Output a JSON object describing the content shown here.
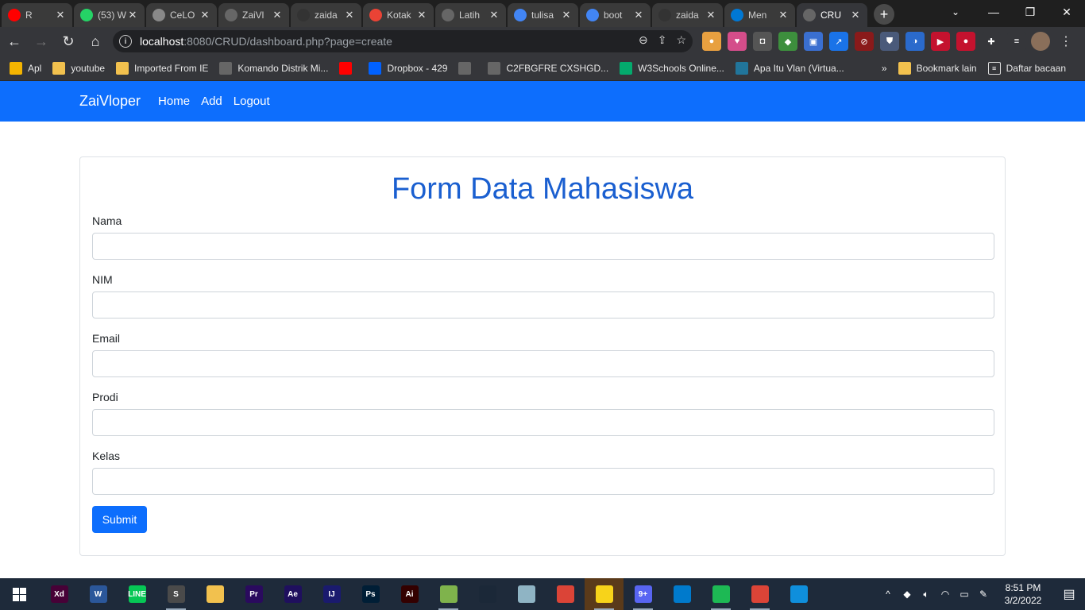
{
  "browser": {
    "tabs": [
      {
        "title": "R",
        "icon": "youtube-icon",
        "color": "#ff0000"
      },
      {
        "title": "(53) W",
        "icon": "whatsapp-icon",
        "color": "#25d366"
      },
      {
        "title": "CeLO",
        "icon": "loading-icon",
        "color": "#888888"
      },
      {
        "title": "ZaiVl",
        "icon": "globe-icon",
        "color": "#666666"
      },
      {
        "title": "zaida",
        "icon": "github-icon",
        "color": "#333333"
      },
      {
        "title": "Kotak",
        "icon": "gmail-icon",
        "color": "#ea4335"
      },
      {
        "title": "Latih",
        "icon": "globe-icon",
        "color": "#666666"
      },
      {
        "title": "tulisa",
        "icon": "google-icon",
        "color": "#4285f4"
      },
      {
        "title": "boot",
        "icon": "google-icon",
        "color": "#4285f4"
      },
      {
        "title": "zaida",
        "icon": "github-icon",
        "color": "#333333"
      },
      {
        "title": "Men",
        "icon": "edge-icon",
        "color": "#0078d4"
      },
      {
        "title": "CRU",
        "icon": "globe-icon",
        "color": "#666666"
      }
    ],
    "new_tab": "+",
    "url_host": "localhost",
    "url_rest": ":8080/CRUD/dashboard.php?page=create",
    "bookmarks": [
      {
        "label": "Apl",
        "icon": "apps-grid-icon",
        "color": "#f4b400"
      },
      {
        "label": "youtube",
        "icon": "folder-icon",
        "color": "#f2c14e"
      },
      {
        "label": "Imported From IE",
        "icon": "folder-icon",
        "color": "#f2c14e"
      },
      {
        "label": "Komando Distrik Mi...",
        "icon": "globe-icon",
        "color": "#666666"
      },
      {
        "label": "",
        "icon": "youtube-icon",
        "color": "#ff0000"
      },
      {
        "label": "Dropbox - 429",
        "icon": "dropbox-icon",
        "color": "#0061ff"
      },
      {
        "label": "",
        "icon": "globe-icon",
        "color": "#666666"
      },
      {
        "label": "C2FBGFRE CXSHGD...",
        "icon": "globe-icon",
        "color": "#666666"
      },
      {
        "label": "W3Schools Online...",
        "icon": "w3schools-icon",
        "color": "#04aa6d"
      },
      {
        "label": "Apa Itu Vlan (Virtua...",
        "icon": "wordpress-icon",
        "color": "#21759b"
      }
    ],
    "bookmarks_overflow": "»",
    "bookmark_other": "Bookmark lain",
    "reading_list": "Daftar bacaan"
  },
  "navbar": {
    "brand": "ZaiVloper",
    "links": [
      "Home",
      "Add",
      "Logout"
    ]
  },
  "form": {
    "title": "Form Data Mahasiswa",
    "fields": [
      {
        "label": "Nama",
        "value": ""
      },
      {
        "label": "NIM",
        "value": ""
      },
      {
        "label": "Email",
        "value": ""
      },
      {
        "label": "Prodi",
        "value": ""
      },
      {
        "label": "Kelas",
        "value": ""
      }
    ],
    "submit_label": "Submit"
  },
  "taskbar": {
    "apps": [
      {
        "name": "xd-icon",
        "text": "Xd",
        "color": "#470137"
      },
      {
        "name": "word-icon",
        "text": "W",
        "color": "#2b579a"
      },
      {
        "name": "line-icon",
        "text": "LINE",
        "color": "#06c755"
      },
      {
        "name": "sublime-icon",
        "text": "S",
        "color": "#4a4a4a"
      },
      {
        "name": "file-explorer-icon",
        "text": "",
        "color": "#f2c14e"
      },
      {
        "name": "premiere-icon",
        "text": "Pr",
        "color": "#2a0a5e"
      },
      {
        "name": "after-effects-icon",
        "text": "Ae",
        "color": "#1f0f5e"
      },
      {
        "name": "intellij-icon",
        "text": "IJ",
        "color": "#1a1a6e"
      },
      {
        "name": "photoshop-icon",
        "text": "Ps",
        "color": "#001e36"
      },
      {
        "name": "illustrator-icon",
        "text": "Ai",
        "color": "#330000"
      },
      {
        "name": "notepad-plus-icon",
        "text": "",
        "color": "#7fb34c"
      },
      {
        "name": "steam-icon",
        "text": "",
        "color": "#1b2838"
      },
      {
        "name": "paint-icon",
        "text": "",
        "color": "#8fb4c4"
      },
      {
        "name": "chrome-icon",
        "text": "",
        "color": "#db4437"
      },
      {
        "name": "sticky-notes-icon",
        "text": "",
        "color": "#f7d31a"
      },
      {
        "name": "discord-icon",
        "text": "9+",
        "color": "#5865f2"
      },
      {
        "name": "vscode-icon",
        "text": "",
        "color": "#007acc"
      },
      {
        "name": "spotify-icon",
        "text": "",
        "color": "#1db954"
      },
      {
        "name": "chrome-icon",
        "text": "",
        "color": "#db4437"
      },
      {
        "name": "edge-icon",
        "text": "",
        "color": "#0f8fdc"
      }
    ],
    "time": "8:51 PM",
    "date": "3/2/2022"
  }
}
